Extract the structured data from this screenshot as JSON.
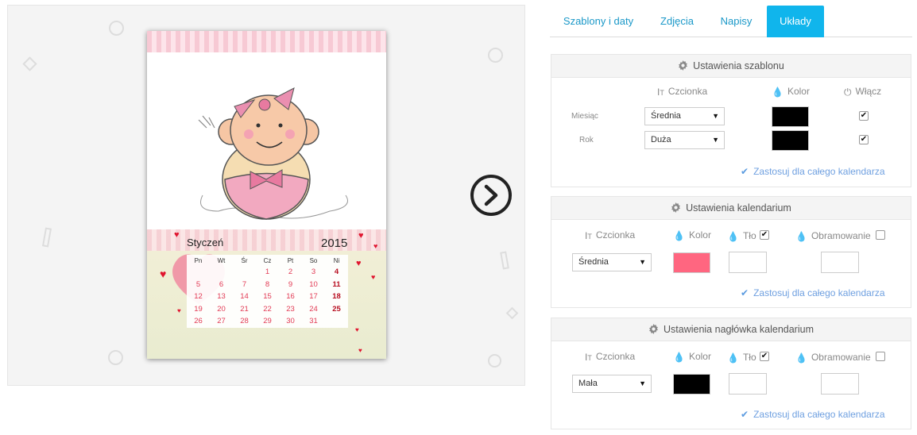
{
  "calendar": {
    "month": "Styczeń",
    "year": "2015",
    "weekdays": [
      "Pn",
      "Wt",
      "Śr",
      "Cz",
      "Pt",
      "So",
      "Ni"
    ],
    "weeks": [
      [
        "",
        "",
        "",
        "1",
        "2",
        "3",
        "4"
      ],
      [
        "5",
        "6",
        "7",
        "8",
        "9",
        "10",
        "11"
      ],
      [
        "12",
        "13",
        "14",
        "15",
        "16",
        "17",
        "18"
      ],
      [
        "19",
        "20",
        "21",
        "22",
        "23",
        "24",
        "25"
      ],
      [
        "26",
        "27",
        "28",
        "29",
        "30",
        "31",
        ""
      ]
    ]
  },
  "tabs": [
    {
      "label": "Szablony i daty",
      "active": false
    },
    {
      "label": "Zdjęcia",
      "active": false
    },
    {
      "label": "Napisy",
      "active": false
    },
    {
      "label": "Układy",
      "active": true
    }
  ],
  "template_settings": {
    "title": "Ustawienia szablonu",
    "col_font": "Czcionka",
    "col_color": "Kolor",
    "col_enable": "Włącz",
    "rows": [
      {
        "label": "Miesiąc",
        "font": "Średnia",
        "color": "#000000",
        "enabled": true
      },
      {
        "label": "Rok",
        "font": "Duża",
        "color": "#000000",
        "enabled": true
      }
    ],
    "apply": "Zastosuj dla całego kalendarza"
  },
  "calendarium_settings": {
    "title": "Ustawienia kalendarium",
    "col_font": "Czcionka",
    "col_color": "Kolor",
    "col_bg": "Tło",
    "col_border": "Obramowanie",
    "bg_checked": true,
    "border_checked": false,
    "font": "Średnia",
    "color": "#ff6680",
    "apply": "Zastosuj dla całego kalendarza"
  },
  "header_settings": {
    "title": "Ustawienia nagłówka kalendarium",
    "col_font": "Czcionka",
    "col_color": "Kolor",
    "col_bg": "Tło",
    "col_border": "Obramowanie",
    "bg_checked": true,
    "border_checked": false,
    "font": "Mała",
    "color": "#000000",
    "apply": "Zastosuj dla całego kalendarza"
  },
  "icons": {
    "next": "chevron-right-circle-icon",
    "gear": "gear-icon",
    "font": "text-height-icon",
    "color": "droplet-icon",
    "power": "power-icon",
    "check": "check-icon"
  }
}
